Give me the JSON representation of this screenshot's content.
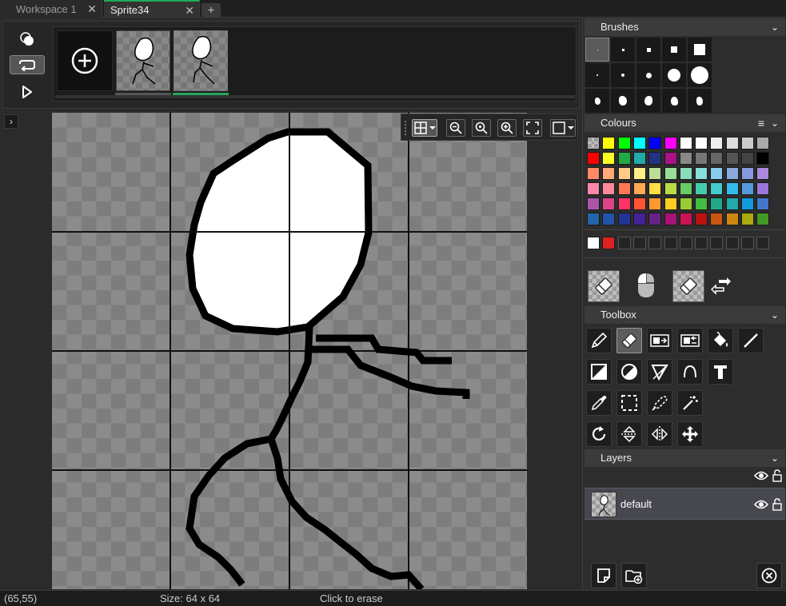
{
  "tabs": [
    {
      "label": "Workspace 1",
      "close": "✕"
    },
    {
      "label": "Sprite34",
      "close": "✕"
    }
  ],
  "tab_add": "+",
  "canvas_expand": "›",
  "panels": {
    "brushes": {
      "title": "Brushes",
      "chevron": "⌄"
    },
    "colours": {
      "title": "Colours",
      "menu": "≡",
      "chevron": "⌄"
    },
    "toolbox": {
      "title": "Toolbox",
      "chevron": "⌄"
    },
    "layers": {
      "title": "Layers",
      "chevron": "⌄"
    }
  },
  "palette_rows": [
    [
      "checker",
      "#ffff00",
      "#00ff00",
      "#00ffff",
      "#0000ff",
      "#ff00ff",
      "#ffffff",
      "#ffffff",
      "#eeeeee",
      "#dddddd",
      "#cccccc",
      "#aaaaaa"
    ],
    [
      "#ff0000",
      "#ffff22",
      "#22aa44",
      "#22aaaa",
      "#223388",
      "#aa1188",
      "#888888",
      "#777777",
      "#666666",
      "#555555",
      "#444444",
      "#000000"
    ],
    [
      "#ff8866",
      "#ffaa77",
      "#ffcc88",
      "#ffee88",
      "#bbdd99",
      "#99dd99",
      "#88ddbb",
      "#88dddd",
      "#88ccee",
      "#88aadd",
      "#8899dd",
      "#aa88dd"
    ],
    [
      "#ff88aa",
      "#ff8899",
      "#ff7755",
      "#ffaa55",
      "#ffdd44",
      "#bbdd44",
      "#66cc66",
      "#44ccaa",
      "#44cccc",
      "#33bbee",
      "#5599dd",
      "#9977dd"
    ],
    [
      "#aa55aa",
      "#dd4488",
      "#ff3366",
      "#ff5533",
      "#ff9933",
      "#ffcc22",
      "#99cc33",
      "#44bb44",
      "#22aa88",
      "#22aaaa",
      "#1199dd",
      "#4477cc"
    ],
    [
      "#2266aa",
      "#2255aa",
      "#223399",
      "#442299",
      "#662288",
      "#aa1177",
      "#cc1155",
      "#bb1111",
      "#cc5511",
      "#cc8811",
      "#aaaa11",
      "#449922"
    ]
  ],
  "custom_colours": [
    "#ffffff",
    "#dd2222"
  ],
  "layers": [
    {
      "name": "default"
    }
  ],
  "status": {
    "coords": "(65,55)",
    "size": "Size: 64 x 64",
    "hint": "Click to erase"
  }
}
